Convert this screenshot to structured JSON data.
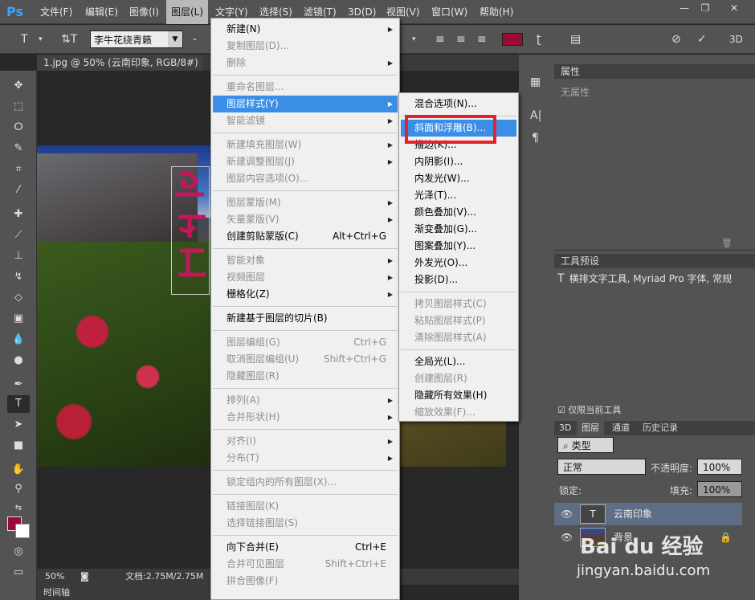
{
  "app": {
    "logo": "Ps"
  },
  "menubar": {
    "items": [
      "文件(F)",
      "编辑(E)",
      "图像(I)",
      "图层(L)",
      "文字(Y)",
      "选择(S)",
      "滤镜(T)",
      "3D(D)",
      "视图(V)",
      "窗口(W)",
      "帮助(H)"
    ],
    "active": "图层(L)"
  },
  "window_controls": {
    "minimize": "—",
    "restore": "❐",
    "close": "✕"
  },
  "options": {
    "font_family": "李牛花绕青籁",
    "color": "#9a0b35",
    "button_3d": "3D"
  },
  "document": {
    "tab_title": "1.jpg @ 50% (云南印象, RGB/8#) *",
    "close": "×",
    "zoom": "50%",
    "doc_size": "文档:2.75M/2.75M",
    "timeline": "时间轴"
  },
  "panels": {
    "properties": {
      "title": "属性",
      "empty": "无属性"
    },
    "tool_presets": {
      "title": "工具预设",
      "item": "横排文字工具, Myriad Pro 字体, 常规",
      "checkbox": "仅限当前工具"
    },
    "layers": {
      "tabs": [
        "3D",
        "图层",
        "通道",
        "历史记录"
      ],
      "active_tab": "图层",
      "filter_kind": "类型",
      "blend_mode": "正常",
      "opacity_label": "不透明度:",
      "opacity": "100%",
      "lock_label": "锁定:",
      "fill_label": "填充:",
      "fill": "100%",
      "rows": [
        {
          "name": "云南印象",
          "type": "text",
          "selected": true
        },
        {
          "name": "背景",
          "type": "image",
          "locked": true
        }
      ]
    }
  },
  "layer_menu": [
    {
      "label": "新建(N)",
      "sub": true
    },
    {
      "label": "复制图层(D)...",
      "disabled": true
    },
    {
      "label": "删除",
      "disabled": true,
      "sub": true
    },
    {
      "sep": true
    },
    {
      "label": "重命名图层...",
      "disabled": true
    },
    {
      "label": "图层样式(Y)",
      "sub": true,
      "highlight": true
    },
    {
      "label": "智能滤镜",
      "disabled": true,
      "sub": true
    },
    {
      "sep": true
    },
    {
      "label": "新建填充图层(W)",
      "disabled": true,
      "sub": true
    },
    {
      "label": "新建调整图层(J)",
      "disabled": true,
      "sub": true
    },
    {
      "label": "图层内容选项(O)...",
      "disabled": true
    },
    {
      "sep": true
    },
    {
      "label": "图层蒙版(M)",
      "disabled": true,
      "sub": true
    },
    {
      "label": "矢量蒙版(V)",
      "disabled": true,
      "sub": true
    },
    {
      "label": "创建剪贴蒙版(C)",
      "shortcut": "Alt+Ctrl+G"
    },
    {
      "sep": true
    },
    {
      "label": "智能对象",
      "disabled": true,
      "sub": true
    },
    {
      "label": "视频图层",
      "disabled": true,
      "sub": true
    },
    {
      "label": "栅格化(Z)",
      "sub": true
    },
    {
      "sep": true
    },
    {
      "label": "新建基于图层的切片(B)"
    },
    {
      "sep": true
    },
    {
      "label": "图层编组(G)",
      "disabled": true,
      "shortcut": "Ctrl+G"
    },
    {
      "label": "取消图层编组(U)",
      "disabled": true,
      "shortcut": "Shift+Ctrl+G"
    },
    {
      "label": "隐藏图层(R)",
      "disabled": true
    },
    {
      "sep": true
    },
    {
      "label": "排列(A)",
      "disabled": true,
      "sub": true
    },
    {
      "label": "合并形状(H)",
      "disabled": true,
      "sub": true
    },
    {
      "sep": true
    },
    {
      "label": "对齐(I)",
      "disabled": true,
      "sub": true
    },
    {
      "label": "分布(T)",
      "disabled": true,
      "sub": true
    },
    {
      "sep": true
    },
    {
      "label": "锁定组内的所有图层(X)...",
      "disabled": true
    },
    {
      "sep": true
    },
    {
      "label": "链接图层(K)",
      "disabled": true
    },
    {
      "label": "选择链接图层(S)",
      "disabled": true
    },
    {
      "sep": true
    },
    {
      "label": "向下合并(E)",
      "shortcut": "Ctrl+E"
    },
    {
      "label": "合并可见图层",
      "disabled": true,
      "shortcut": "Shift+Ctrl+E"
    },
    {
      "label": "拼合图像(F)",
      "disabled": true
    }
  ],
  "style_submenu": [
    {
      "label": "混合选项(N)..."
    },
    {
      "sep": true
    },
    {
      "label": "斜面和浮雕(B)...",
      "highlight": true
    },
    {
      "label": "描边(K)..."
    },
    {
      "label": "内阴影(I)..."
    },
    {
      "label": "内发光(W)..."
    },
    {
      "label": "光泽(T)..."
    },
    {
      "label": "颜色叠加(V)..."
    },
    {
      "label": "渐变叠加(G)..."
    },
    {
      "label": "图案叠加(Y)..."
    },
    {
      "label": "外发光(O)..."
    },
    {
      "label": "投影(D)..."
    },
    {
      "sep": true
    },
    {
      "label": "拷贝图层样式(C)",
      "disabled": true
    },
    {
      "label": "粘贴图层样式(P)",
      "disabled": true
    },
    {
      "label": "清除图层样式(A)",
      "disabled": true
    },
    {
      "sep": true
    },
    {
      "label": "全局光(L)..."
    },
    {
      "label": "创建图层(R)",
      "disabled": true
    },
    {
      "label": "隐藏所有效果(H)"
    },
    {
      "label": "缩放效果(F)...",
      "disabled": true
    }
  ],
  "watermark": {
    "brand": "Bai du 经验",
    "url": "jingyan.baidu.com"
  }
}
